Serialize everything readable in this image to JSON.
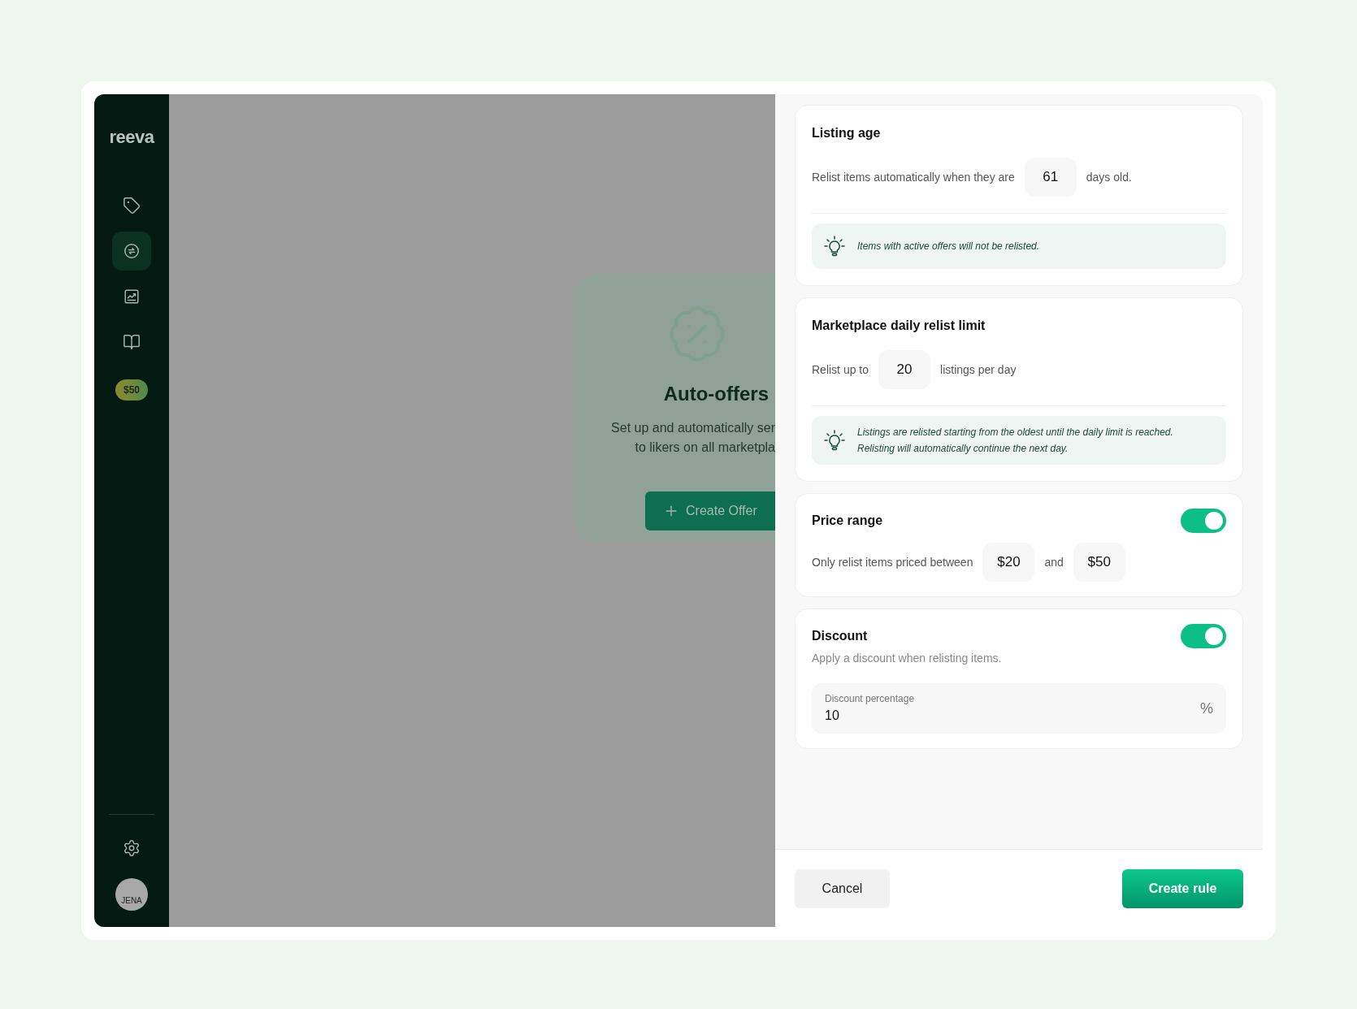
{
  "sidebar": {
    "logo": "reeva",
    "nav_items": [
      {
        "kind": "tag",
        "selected": false
      },
      {
        "kind": "relist",
        "selected": true
      },
      {
        "kind": "chart",
        "selected": false
      },
      {
        "kind": "book",
        "selected": false
      }
    ],
    "credit_badge": "$50",
    "avatar_initials": "JENA"
  },
  "background": {
    "title": "Auto-offers",
    "description_lines": [
      "Set up and automatically ser",
      "to likers on all marketpla"
    ],
    "button": "Create Offer"
  },
  "sections": [
    {
      "kind": "listing_age",
      "title": "Listing age",
      "before": "Relist items automatically when they are",
      "value": "61",
      "after": "days old.",
      "hint_lines": [
        "Items with active offers will not be relisted."
      ]
    },
    {
      "kind": "daily_limit",
      "title": "Marketplace daily relist limit",
      "before": "Relist up to",
      "value": "20",
      "after": "listings per day",
      "hint_lines": [
        "Listings are relisted starting from the oldest until the daily limit is reached.",
        "Relisting will automatically continue the next day."
      ]
    },
    {
      "kind": "price_range",
      "title": "Price range",
      "on": true,
      "before": "Only relist items priced between",
      "min": "$20",
      "joiner": "and",
      "max": "$50"
    },
    {
      "kind": "discount",
      "title": "Discount",
      "on": true,
      "description": "Apply a discount when relisting items.",
      "field_label": "Discount percentage",
      "value": "10",
      "unit": "%"
    }
  ],
  "footer": {
    "cancel": "Cancel",
    "submit": "Create rule"
  }
}
